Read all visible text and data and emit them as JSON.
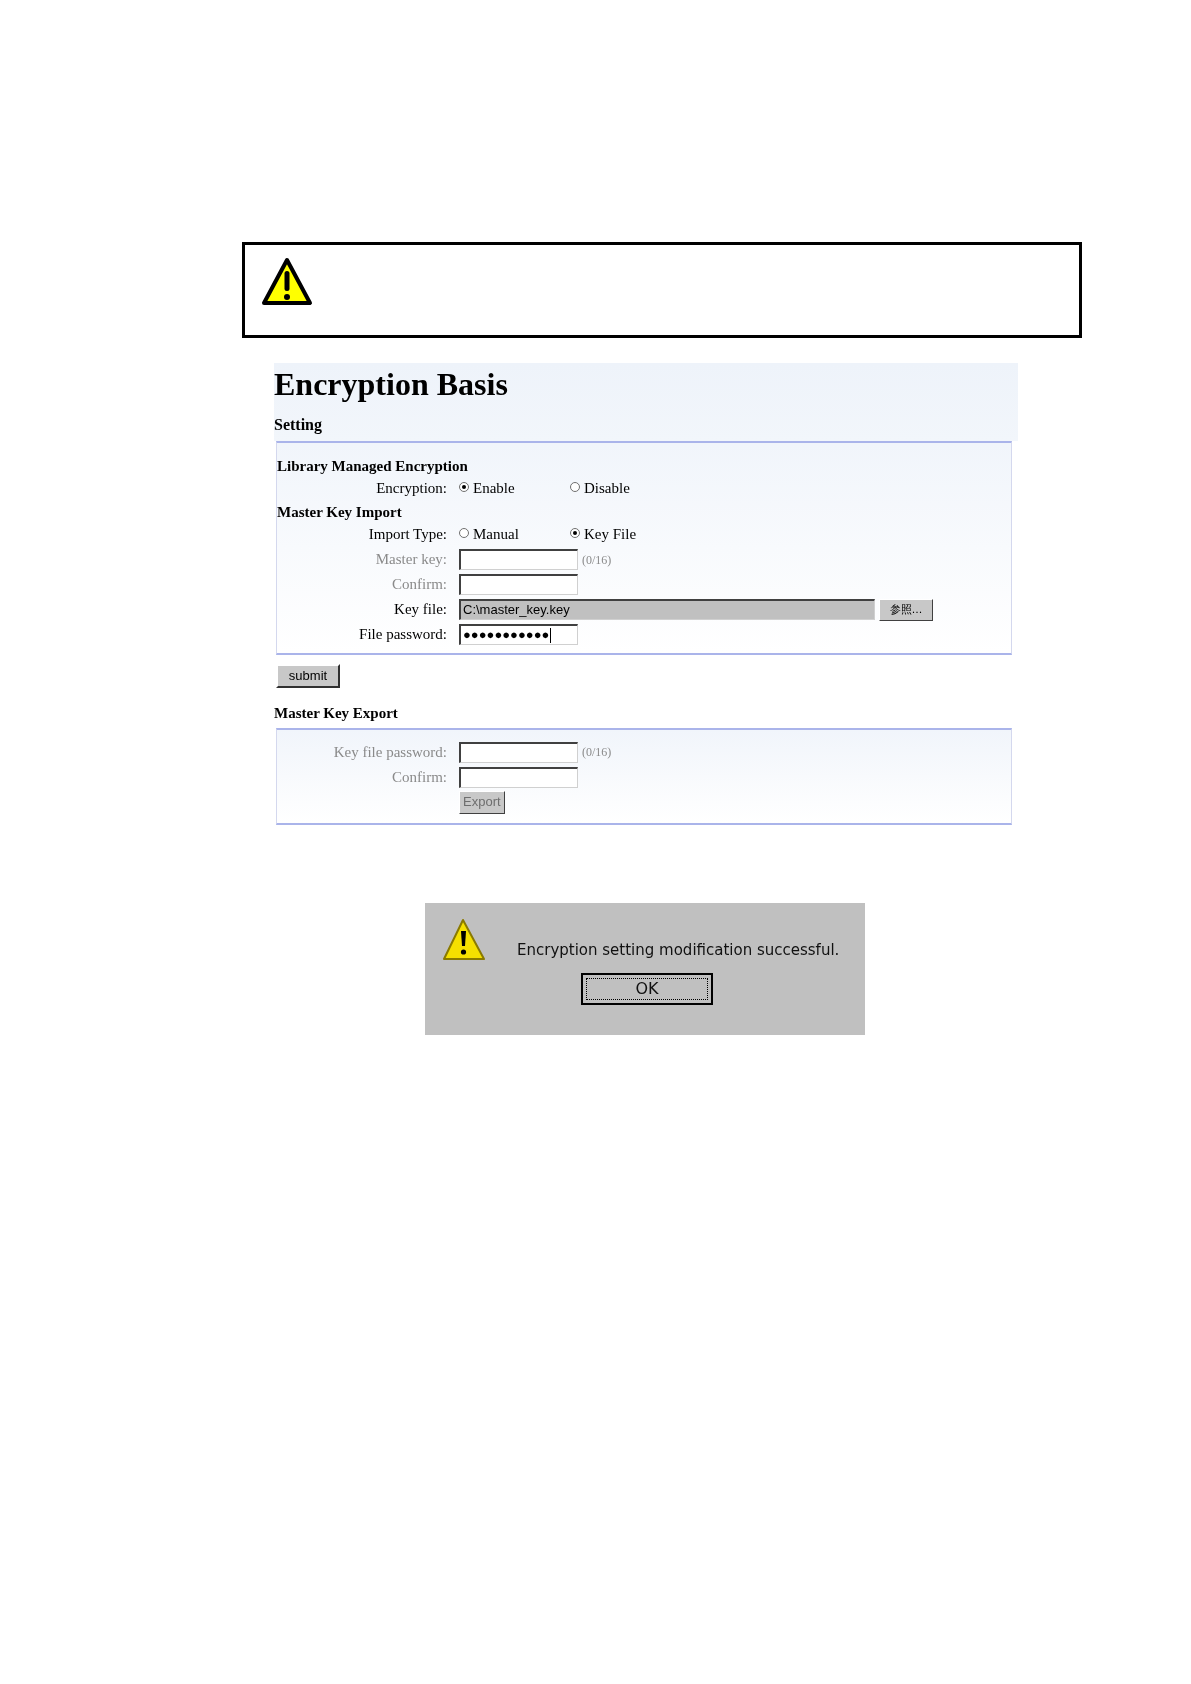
{
  "form": {
    "title": "Encryption Basis",
    "section": "Setting",
    "groups": [
      {
        "heading": "Library Managed Encryption",
        "rows": [
          {
            "kind": "radio",
            "label": "Encryption:",
            "disabled": false,
            "options": [
              {
                "label": "Enable",
                "selected": true
              },
              {
                "label": "Disable",
                "selected": false
              }
            ]
          }
        ]
      },
      {
        "heading": "Master Key Import",
        "rows": [
          {
            "kind": "radio",
            "label": "Import Type:",
            "disabled": false,
            "options": [
              {
                "label": "Manual",
                "selected": false
              },
              {
                "label": "Key File",
                "selected": true
              }
            ]
          },
          {
            "kind": "text",
            "label": "Master key:",
            "disabled": true,
            "counter": "(0/16)"
          },
          {
            "kind": "text",
            "label": "Confirm:",
            "disabled": true
          },
          {
            "kind": "file",
            "label": "Key file:",
            "disabled": false,
            "value": "C:\\master_key.key",
            "button": "参照..."
          },
          {
            "kind": "text",
            "label": "File password:",
            "disabled": false,
            "value": "●●●●●●●●●●●",
            "focused": true
          }
        ]
      }
    ],
    "submit": "submit",
    "export": {
      "heading": "Master Key Export",
      "rows": [
        {
          "kind": "text",
          "label": "Key file password:",
          "disabled": true,
          "counter": "(0/16)"
        },
        {
          "kind": "text",
          "label": "Confirm:",
          "disabled": true
        },
        {
          "kind": "button",
          "label": "Export",
          "disabled": true
        }
      ]
    }
  },
  "dialog": {
    "message": "Encryption setting modification successful.",
    "button": "OK"
  }
}
